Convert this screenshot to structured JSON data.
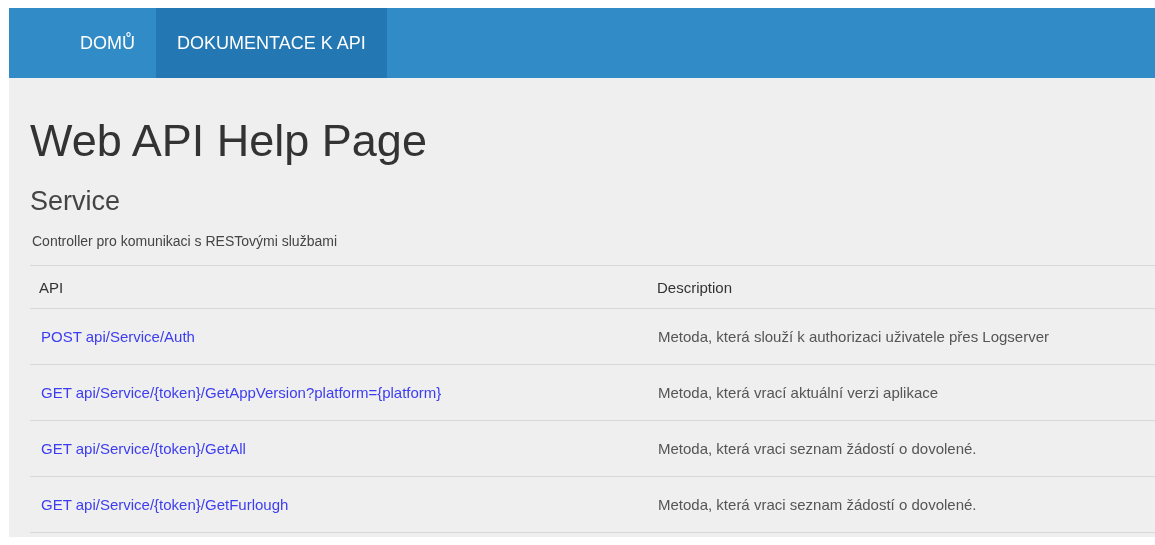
{
  "nav": {
    "items": [
      {
        "label": "DOMŮ",
        "selected": false
      },
      {
        "label": "DOKUMENTACE K API",
        "selected": true
      }
    ]
  },
  "title": "Web API Help Page",
  "section": {
    "title": "Service",
    "description": "Controller pro komunikaci s RESTovými službami"
  },
  "table": {
    "columns": [
      "API",
      "Description"
    ],
    "rows": [
      {
        "api": "POST api/Service/Auth",
        "description": "Metoda, která slouží k authorizaci uživatele přes Logserver"
      },
      {
        "api": "GET api/Service/{token}/GetAppVersion?platform={platform}",
        "description": "Metoda, která vrací aktuální verzi aplikace"
      },
      {
        "api": "GET api/Service/{token}/GetAll",
        "description": "Metoda, která vraci seznam žádostí o dovolené."
      },
      {
        "api": "GET api/Service/{token}/GetFurlough",
        "description": "Metoda, která vraci seznam žádostí o dovolené."
      }
    ]
  }
}
